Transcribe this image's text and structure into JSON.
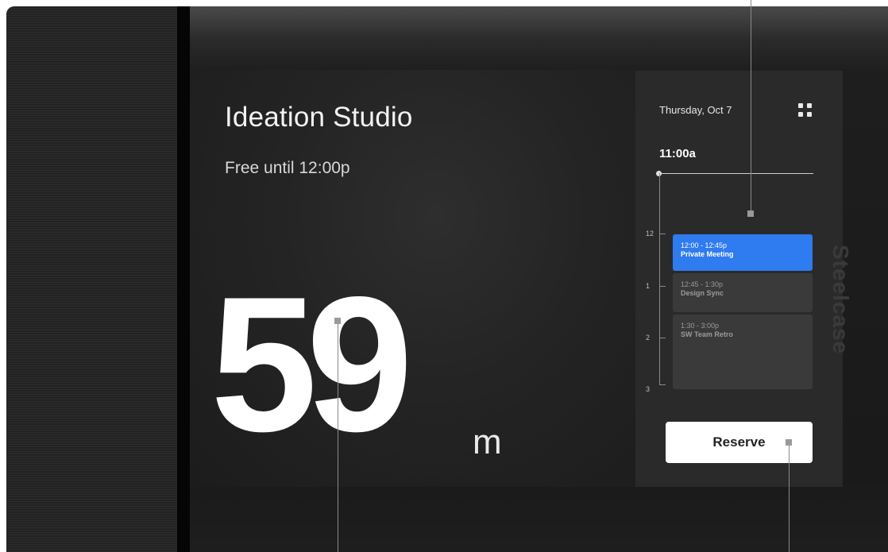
{
  "room": {
    "name": "Ideation Studio",
    "status": "Free until 12:00p",
    "minutes": "59",
    "minutes_unit": "m"
  },
  "schedule": {
    "date": "Thursday, Oct 7",
    "current_time": "11:00a",
    "hour_labels": [
      "12",
      "1",
      "2",
      "3"
    ],
    "events": [
      {
        "time": "12:00 - 12:45p",
        "title": "Private Meeting",
        "color": "#2f7bf0"
      },
      {
        "time": "12:45 - 1:30p",
        "title": "Design Sync",
        "color": "#3a3a3a"
      },
      {
        "time": "1:30 - 3:00p",
        "title": "SW Team Retro",
        "color": "#3a3a3a"
      }
    ],
    "reserve_label": "Reserve",
    "menu_icon": "grid-icon"
  },
  "brand": "Steelcase",
  "colors": {
    "accent": "#2f7bf0",
    "background": "#1e1e1e",
    "panel": "#2a2a2a"
  }
}
